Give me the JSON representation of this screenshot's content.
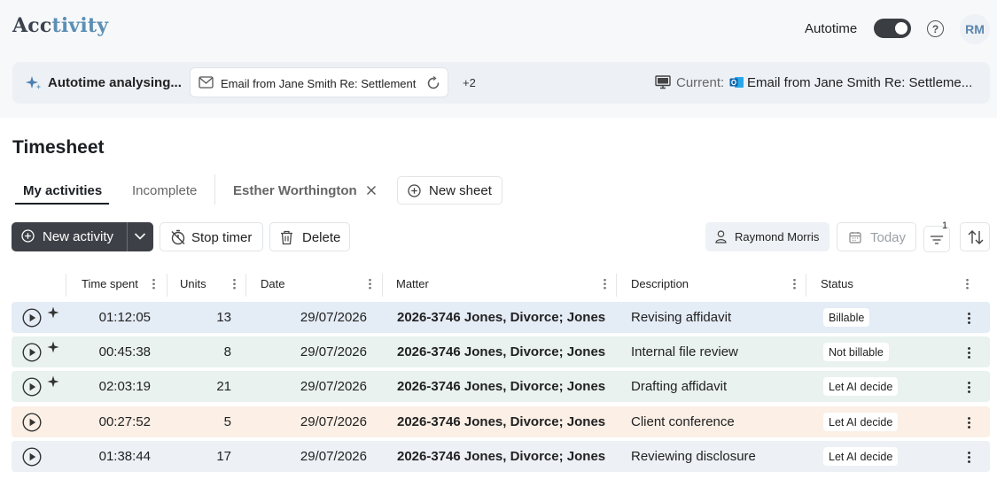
{
  "app": {
    "logo_part1": "Acc",
    "logo_part2": "tivity",
    "autotime_label": "Autotime",
    "autotime_enabled": true,
    "user_initials": "RM"
  },
  "banner": {
    "status": "Autotime analysing...",
    "email_chip": "Email from Jane Smith Re: Settlement",
    "more_count": "+2",
    "current_label": "Current:",
    "current_email": "Email from Jane Smith Re: Settleme..."
  },
  "timesheet": {
    "title": "Timesheet",
    "tabs": [
      {
        "label": "My activities"
      },
      {
        "label": "Incomplete"
      },
      {
        "label": "Esther Worthington"
      }
    ],
    "new_sheet_label": "New sheet"
  },
  "toolbar": {
    "new_activity": "New activity",
    "stop_timer": "Stop timer",
    "delete": "Delete",
    "person": "Raymond Morris",
    "today": "Today",
    "filter_count": "1"
  },
  "table": {
    "columns": [
      "Time spent",
      "Units",
      "Date",
      "Matter",
      "Description",
      "Status"
    ],
    "rows": [
      {
        "time": "01:12:05",
        "units": "13",
        "date": "29/07/2026",
        "matter": "2026-3746 Jones, Divorce; Jones",
        "description": "Revising affidavit",
        "status": "Billable",
        "ai": true,
        "bg": "#e4ecf6"
      },
      {
        "time": "00:45:38",
        "units": "8",
        "date": "29/07/2026",
        "matter": "2026-3746 Jones, Divorce; Jones",
        "description": "Internal file review",
        "status": "Not billable",
        "ai": true,
        "bg": "#e9f2ee"
      },
      {
        "time": "02:03:19",
        "units": "21",
        "date": "29/07/2026",
        "matter": "2026-3746 Jones, Divorce; Jones",
        "description": "Drafting affidavit",
        "status": "Let AI decide",
        "ai": true,
        "bg": "#e9f2ee"
      },
      {
        "time": "00:27:52",
        "units": "5",
        "date": "29/07/2026",
        "matter": "2026-3746 Jones, Divorce; Jones",
        "description": "Client conference",
        "status": "Let AI decide",
        "ai": false,
        "bg": "#fbefe6"
      },
      {
        "time": "01:38:44",
        "units": "17",
        "date": "29/07/2026",
        "matter": "2026-3746 Jones, Divorce; Jones",
        "description": "Reviewing disclosure",
        "status": "Let AI decide",
        "ai": false,
        "bg": "#edf0f5"
      }
    ]
  }
}
